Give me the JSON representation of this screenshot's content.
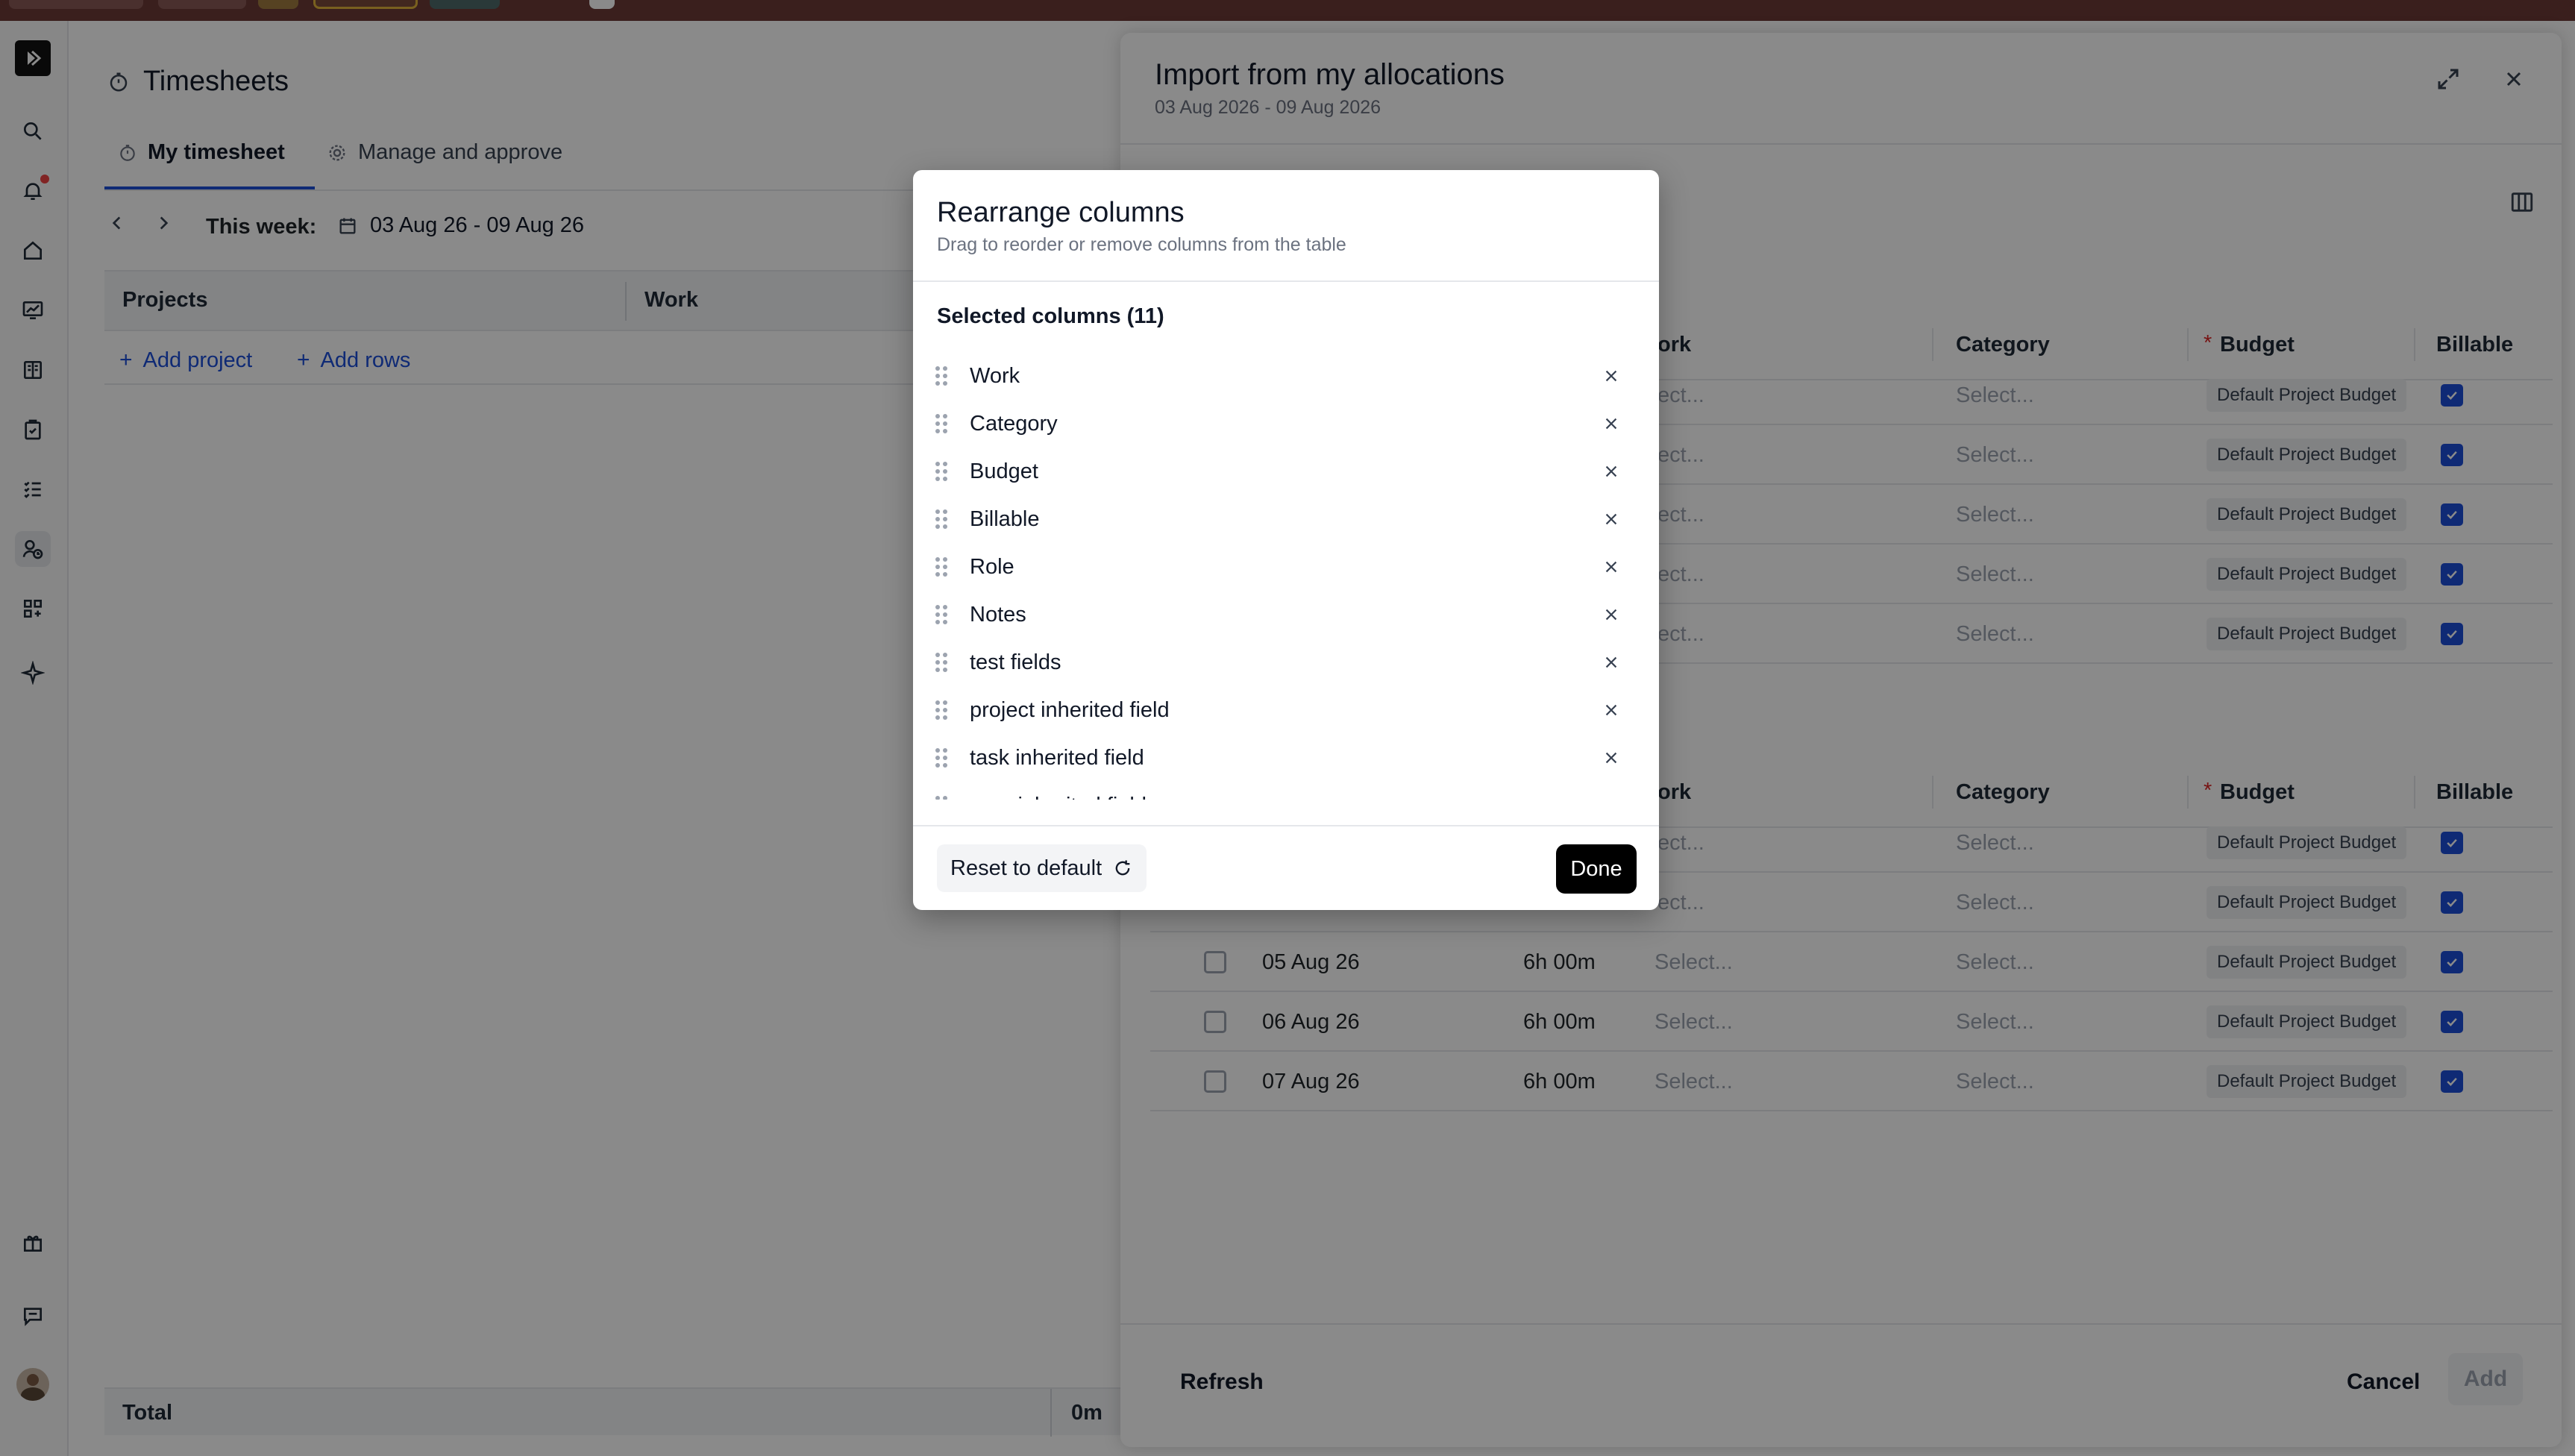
{
  "colors": {
    "accent": "#1d4ed8",
    "topbar": "#6b3a36",
    "notification_dot": "#ef4444",
    "overlay": "rgba(0,0,0,0.46)"
  },
  "rail": {
    "icons": [
      "logo-icon",
      "search-icon",
      "bell-icon",
      "home-icon",
      "chart-icon",
      "book-icon",
      "clipboard-icon",
      "checklist-icon",
      "user-clock-icon",
      "apps-icon",
      "sparkle-icon",
      "gift-icon",
      "chat-icon",
      "avatar"
    ]
  },
  "timesheet": {
    "title": "Timesheets",
    "tabs": [
      {
        "label": "My timesheet",
        "active": true
      },
      {
        "label": "Manage and approve",
        "active": false
      }
    ],
    "week_label": "This week:",
    "week_range": "03 Aug 26 - 09 Aug 26",
    "columns": [
      "Projects",
      "Work"
    ],
    "add_project": "Add project",
    "add_rows": "Add rows",
    "total_label": "Total",
    "total_value": "0m"
  },
  "panel": {
    "title": "Import from my allocations",
    "subtitle": "03 Aug 2026 - 09 Aug 2026",
    "columns": {
      "work_partial": "ork",
      "category": "Category",
      "budget": "Budget",
      "budget_required": "*",
      "billable": "Billable"
    },
    "select_placeholder": "Select...",
    "select_placeholder_partial": "ect...",
    "budget_chip": "Default Project Budget",
    "group1_rows": 5,
    "group2_rows": [
      {
        "date": "",
        "hours": ""
      },
      {
        "date": "",
        "hours": ""
      },
      {
        "date": "05 Aug 26",
        "hours": "6h 00m"
      },
      {
        "date": "06 Aug 26",
        "hours": "6h 00m"
      },
      {
        "date": "07 Aug 26",
        "hours": "6h 00m"
      }
    ],
    "refresh": "Refresh",
    "cancel": "Cancel",
    "add": "Add"
  },
  "modal": {
    "title": "Rearrange columns",
    "subtitle": "Drag to reorder or remove columns from the table",
    "section": "Selected columns (11)",
    "items": [
      "Work",
      "Category",
      "Budget",
      "Billable",
      "Role",
      "Notes",
      "test fields",
      "project inherited field",
      "task inherited field",
      "user inherited field"
    ],
    "reset": "Reset to default",
    "done": "Done"
  }
}
